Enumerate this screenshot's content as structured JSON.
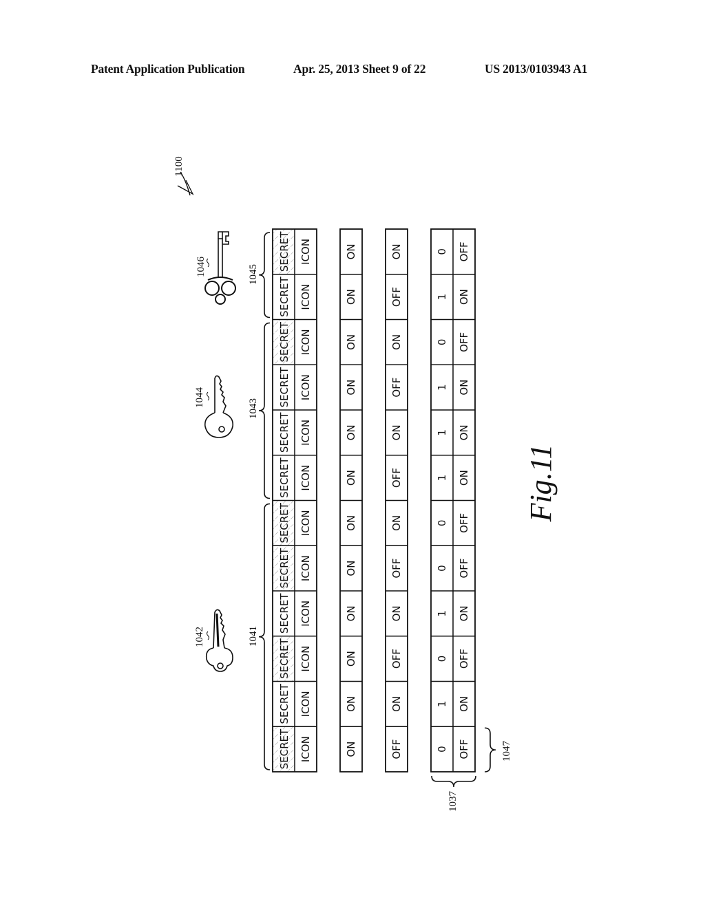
{
  "header": {
    "left": "Patent Application Publication",
    "middle": "Apr. 25, 2013  Sheet 9 of 22",
    "right": "US 2013/0103943 A1"
  },
  "figure": {
    "ref_label": "1100",
    "caption": "Fig.11",
    "columns": [
      {
        "name": "secret-icon-row",
        "type": "double",
        "left_text": "SECRET",
        "right_text": "ICON"
      },
      {
        "name": "all-on-row",
        "values": [
          "ON",
          "ON",
          "ON",
          "ON",
          "ON",
          "ON",
          "ON",
          "ON",
          "ON",
          "ON",
          "ON",
          "ON"
        ]
      },
      {
        "name": "alternating-row",
        "values": [
          "ON",
          "OFF",
          "ON",
          "OFF",
          "ON",
          "OFF",
          "ON",
          "OFF",
          "ON",
          "OFF",
          "ON",
          "OFF"
        ]
      },
      {
        "name": "bit-row",
        "bits": [
          "0",
          "1",
          "0",
          "1",
          "1",
          "1",
          "0",
          "0",
          "1",
          "0",
          "1",
          "0"
        ],
        "states": [
          "OFF",
          "ON",
          "OFF",
          "ON",
          "ON",
          "ON",
          "OFF",
          "OFF",
          "ON",
          "OFF",
          "ON",
          "OFF"
        ]
      }
    ],
    "secret_hatched": [
      true,
      false,
      true,
      false,
      false,
      false,
      true,
      true,
      false,
      true,
      false,
      true
    ],
    "groups": [
      {
        "label": "1045",
        "key_label": "1046",
        "key_type": "skeleton-key",
        "start": 0,
        "end": 1
      },
      {
        "label": "1043",
        "key_label": "1044",
        "key_type": "modern-key",
        "start": 2,
        "end": 5
      },
      {
        "label": "1041",
        "key_label": "1042",
        "key_type": "pin-tumbler-key",
        "start": 6,
        "end": 11
      }
    ],
    "bottom_labels": {
      "column_brace": "1047",
      "row_brace": "1037"
    }
  }
}
